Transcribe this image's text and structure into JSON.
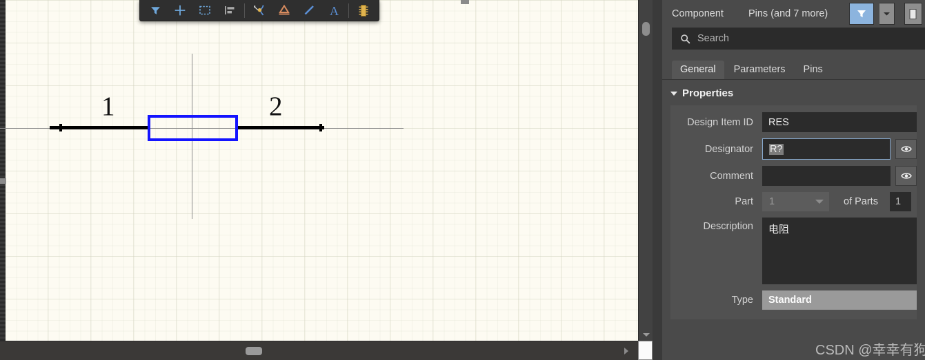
{
  "toolbar": {
    "items": [
      {
        "name": "filter-icon",
        "title": "Filter"
      },
      {
        "name": "crosshair-icon",
        "title": "Cross Probe"
      },
      {
        "name": "select-area-icon",
        "title": "Select Area"
      },
      {
        "name": "align-icon",
        "title": "Align"
      },
      {
        "name": "place-wire-icon",
        "title": "Place Wire"
      },
      {
        "name": "place-net-label-icon",
        "title": "Place Net Label"
      },
      {
        "name": "place-line-icon",
        "title": "Place Line"
      },
      {
        "name": "place-text-icon",
        "title": "Place Text"
      },
      {
        "name": "place-part-icon",
        "title": "Place Part"
      }
    ]
  },
  "canvas": {
    "pin1_label": "1",
    "pin2_label": "2",
    "symbol": "resistor"
  },
  "panel": {
    "object_type": "Component",
    "scope": "Pins (and 7 more)",
    "filter_button": "filter-icon",
    "filter_dropdown": "chevron-down-icon",
    "document_button": "document-icon",
    "search": {
      "placeholder": "Search",
      "icon": "search-icon",
      "value": ""
    },
    "tabs": [
      {
        "label": "General",
        "active": true
      },
      {
        "label": "Parameters",
        "active": false
      },
      {
        "label": "Pins",
        "active": false
      }
    ],
    "section_title": "Properties",
    "fields": {
      "design_item_id": {
        "label": "Design Item ID",
        "value": "RES"
      },
      "designator": {
        "label": "Designator",
        "value": "R?",
        "selected": true,
        "visibility_icon": "eye-icon"
      },
      "comment": {
        "label": "Comment",
        "value": "",
        "visibility_icon": "eye-icon"
      },
      "part": {
        "label": "Part",
        "value": "1",
        "of_parts_label": "of Parts",
        "of_parts_value": "1"
      },
      "description": {
        "label": "Description",
        "value": "电阻"
      },
      "type": {
        "label": "Type",
        "value": "Standard"
      }
    }
  },
  "watermark": "CSDN @幸幸有狗",
  "colors": {
    "canvas_bg": "#fdfbf2",
    "symbol_outline": "#1414ff",
    "panel_bg": "#4a4a4a",
    "accent_blue": "#8cb4de",
    "field_bg": "#2b2b2b"
  }
}
